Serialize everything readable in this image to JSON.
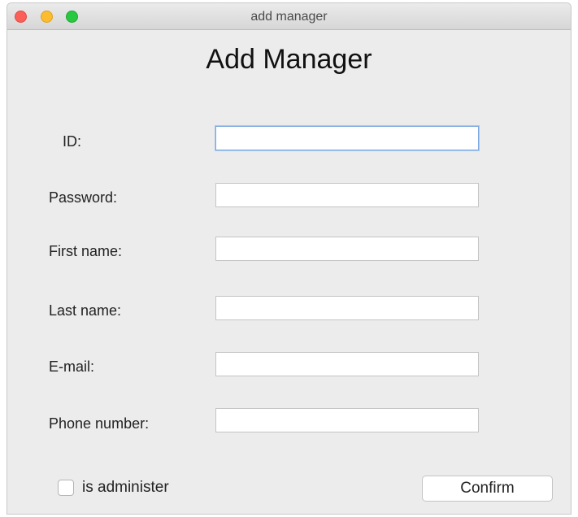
{
  "window": {
    "title": "add manager"
  },
  "heading": "Add Manager",
  "form": {
    "id_label": "ID:",
    "id_value": "",
    "password_label": "Password:",
    "password_value": "",
    "first_name_label": "First name:",
    "first_name_value": "",
    "last_name_label": "Last name:",
    "last_name_value": "",
    "email_label": "E-mail:",
    "email_value": "",
    "phone_label": "Phone number:",
    "phone_value": ""
  },
  "administer": {
    "label": "is administer",
    "checked": false
  },
  "confirm_label": "Confirm",
  "colors": {
    "close": "#fc5f57",
    "minimize": "#fdbc2e",
    "maximize": "#28c840",
    "focus_ring": "#7aa7e0"
  }
}
